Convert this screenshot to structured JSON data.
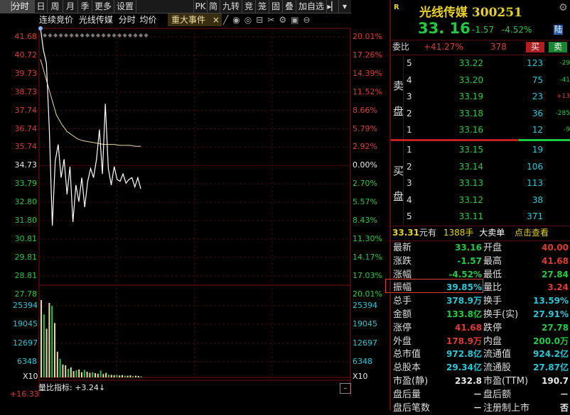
{
  "toolbar": {
    "tabs": [
      "分时",
      "日",
      "周",
      "月",
      "季",
      "更多",
      "设置"
    ],
    "right_tabs": [
      "PK",
      "简",
      "九转",
      "竞",
      "笼",
      "固",
      "叠",
      "加自选"
    ]
  },
  "chart_header": {
    "auction": "连续竞价",
    "stock_name": "光线传媒",
    "fenshi": "分时",
    "avg": "均价",
    "event_tab": "重大事件",
    "close": "×"
  },
  "price_axis": {
    "left": [
      "41.68",
      "40.72",
      "39.73",
      "38.73",
      "37.74",
      "36.74",
      "35.74",
      "34.73",
      "33.79",
      "32.80",
      "31.80",
      "30.81",
      "29.81",
      "28.81",
      "27.78"
    ],
    "right": [
      "20.01%",
      "17.26%",
      "14.39%",
      "11.52%",
      "8.66%",
      "5.79%",
      "2.92%",
      "0.00%",
      "2.70%",
      "5.57%",
      "8.43%",
      "11.30%",
      "14.17%",
      "17.03%",
      "20.01%"
    ]
  },
  "volume_axis": {
    "labels": [
      "25394",
      "19045",
      "12697",
      "6348"
    ],
    "unit": "X10"
  },
  "volume_ratio": {
    "label": "量比指标:",
    "value": "+3.24",
    "left_value": "+16.33"
  },
  "chart_data": {
    "type": "line",
    "price_series": [
      41.68,
      40.5,
      39.8,
      36.2,
      31.0,
      34.5,
      35.4,
      33.6,
      34.6,
      32.7,
      34.2,
      31.2,
      33.2,
      32.3,
      33.6,
      32.0,
      33.4,
      34.1,
      33.6,
      34.6,
      36.2,
      33.8,
      37.6,
      34.1,
      33.2,
      34.2,
      33.5,
      33.4,
      33.8,
      33.3,
      33.5,
      33.6,
      33.1,
      33.6,
      33.0
    ],
    "avg_series": [
      40.0,
      39.0,
      38.0,
      37.0,
      36.5,
      36.1,
      35.9,
      35.7,
      35.6,
      35.55,
      35.5,
      35.45,
      35.4,
      35.4,
      35.4,
      35.35,
      35.35,
      35.35,
      35.3,
      35.3
    ],
    "volumes": [
      27000,
      22000,
      17000,
      26000,
      25000,
      19000,
      9000,
      6500,
      4500,
      4200,
      3000,
      3500,
      2200,
      2500,
      2800,
      1800,
      2600,
      2000,
      1600,
      1800,
      1500,
      1300,
      2400,
      1200,
      1600,
      1000,
      900,
      800,
      900,
      700,
      800,
      600,
      600,
      700,
      500,
      600,
      500,
      400
    ],
    "ylim": [
      27.78,
      41.68
    ],
    "prev_close": 34.73
  },
  "quote": {
    "title": "光线传媒 300251",
    "price": "33. 16",
    "change": "-1.57",
    "change_pct": "-4.52%",
    "market_tag": "陆",
    "weibi_label": "委比",
    "weibi_value": "+41.27%",
    "weibi_diff": "378",
    "buy_btn": "买",
    "sell_btn": "卖"
  },
  "sell_side": {
    "label_top": "卖",
    "label_bottom": "盘",
    "rows": [
      {
        "n": "5",
        "price": "33.22",
        "vol": "123",
        "delta": "-29"
      },
      {
        "n": "4",
        "price": "33.20",
        "vol": "75",
        "delta": "-41"
      },
      {
        "n": "3",
        "price": "33.19",
        "vol": "23",
        "delta": "+13"
      },
      {
        "n": "2",
        "price": "33.18",
        "vol": "36",
        "delta": "-285"
      },
      {
        "n": "1",
        "price": "33.16",
        "vol": "12",
        "delta": "-9"
      }
    ]
  },
  "buy_side": {
    "label_top": "买",
    "label_bottom": "盘",
    "rows": [
      {
        "n": "1",
        "price": "33.15",
        "vol": "19"
      },
      {
        "n": "2",
        "price": "33.14",
        "vol": "106"
      },
      {
        "n": "3",
        "price": "33.13",
        "vol": "113"
      },
      {
        "n": "4",
        "price": "33.12",
        "vol": "38"
      },
      {
        "n": "5",
        "price": "33.11",
        "vol": "371"
      }
    ]
  },
  "big_order": {
    "price": "33.31",
    "unit1": "元有",
    "vol": "1388手",
    "label": "大卖单",
    "action": "点击查看"
  },
  "stats": [
    {
      "l1": "最新",
      "v1": "33.16",
      "l2": "开盘",
      "v2": "40.00"
    },
    {
      "l1": "涨跌",
      "v1": "-1.57",
      "l2": "最高",
      "v2": "41.68"
    },
    {
      "l1": "涨幅",
      "v1": "-4.52%",
      "l2": "最低",
      "v2": "27.84"
    },
    {
      "l1": "振幅",
      "v1": "39.85%",
      "l2": "量比",
      "v2": "3.24"
    },
    {
      "l1": "总手",
      "v1": "378.9万",
      "l2": "换手",
      "v2": "13.59%"
    },
    {
      "l1": "金额",
      "v1": "133.8亿",
      "l2": "换手(实)",
      "v2": "27.91%"
    },
    {
      "l1": "涨停",
      "v1": "41.68",
      "l2": "跌停",
      "v2": "27.78"
    },
    {
      "l1": "外盘",
      "v1": "178.9万",
      "l2": "内盘",
      "v2": "200.0万"
    },
    {
      "l1": "总市值",
      "v1": "972.8亿",
      "l2": "流通值",
      "v2": "924.2亿"
    },
    {
      "l1": "总股本",
      "v1": "29.34亿",
      "l2": "流通股",
      "v2": "27.87亿"
    },
    {
      "l1": "市盈(静)",
      "v1": "232.8",
      "l2": "市盈(TTM)",
      "v2": "190.7"
    },
    {
      "l1": "盘后量",
      "v1": "－",
      "l2": "盘后额",
      "v2": "－"
    },
    {
      "l1": "盘后笔数",
      "v1": "－",
      "l2": "注册制上市",
      "v2": "否"
    }
  ],
  "colors": {
    "up": "#e03a2e",
    "down": "#1ecb3e",
    "value": "#22c8d8",
    "grid": "#5a0b0b",
    "highlight": "#e03a2e"
  }
}
